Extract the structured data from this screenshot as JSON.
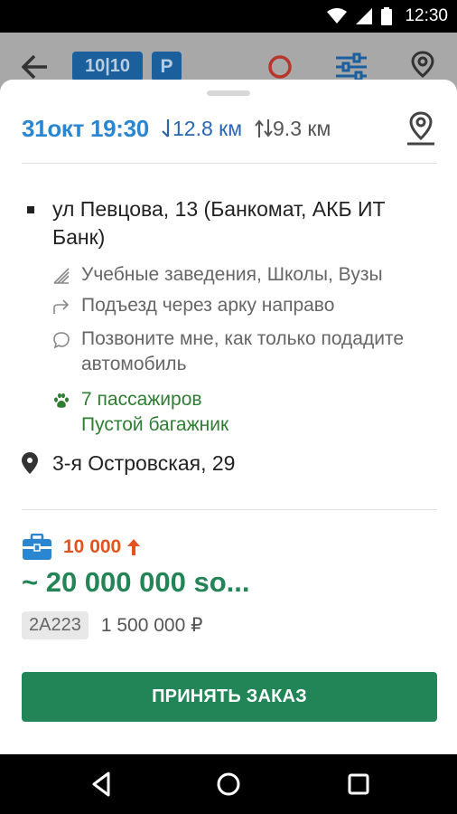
{
  "status_bar": {
    "time": "12:30"
  },
  "toolbar": {
    "counter_badge": "10|10",
    "parking_badge": "P",
    "icons": [
      "back-arrow-icon",
      "circle-icon",
      "filter-icon",
      "location-pin-icon"
    ]
  },
  "order": {
    "date_time": "31окт 19:30",
    "distance_to_client": "12.8 км",
    "trip_distance": "9.3 км",
    "pickup_address": "ул Певцова, 13 (Банкомат, АКБ ИТ Банк)",
    "pickup_details": [
      {
        "icon": "landmark-icon",
        "text": "Учебные заведения, Школы, Вузы"
      },
      {
        "icon": "turn-right-icon",
        "text": "Подъезд через арку направо"
      },
      {
        "icon": "comment-icon",
        "text": "Позвоните мне, как только подадите автомобиль"
      }
    ],
    "extras": {
      "icon": "paw-icon",
      "line1": "7 пассажиров",
      "line2": "Пустой багажник"
    },
    "destination_address": "3-я Островская, 29",
    "bonus": "10 000",
    "total": "~ 20 000 000 so...",
    "tariff_code": "2A223",
    "tariff_price": "1 500 000 ₽",
    "accept_label": "ПРИНЯТЬ ЗАКАЗ"
  },
  "colors": {
    "accent_blue": "#2a86d1",
    "price_green": "#238456",
    "bonus_orange": "#e2531f",
    "button_green": "#218557"
  }
}
